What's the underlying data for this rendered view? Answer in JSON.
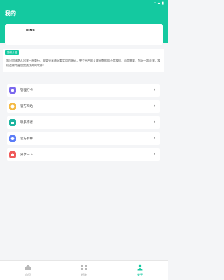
{
  "status": {
    "icons": [
      "wifi-icon",
      "signal-icon",
      "battery-icon"
    ]
  },
  "header": {
    "title": "我的"
  },
  "profile": {
    "username": "mos"
  },
  "intro": {
    "tag": "猫咪介绍",
    "description": "知识加速跑从出来一直重行，支管分享最好看实用的源码，整个平台的互联网数据都不是我们，而是需要，您好一路走来，我们会做得更加完美优秀的软件！"
  },
  "menu": [
    {
      "label": "管理打卡",
      "icon": "user-manage-icon",
      "color": "#7b68ee"
    },
    {
      "label": "官方网站",
      "icon": "website-icon",
      "color": "#f4b942"
    },
    {
      "label": "联系作者",
      "icon": "contact-icon",
      "color": "#1db4a0"
    },
    {
      "label": "官方群聊",
      "icon": "group-chat-icon",
      "color": "#5b7cf7"
    },
    {
      "label": "分享一下",
      "icon": "share-icon",
      "color": "#ef5a5a"
    }
  ],
  "nav": [
    {
      "label": "首页",
      "icon": "home-icon",
      "active": false
    },
    {
      "label": "模块",
      "icon": "grid-icon",
      "active": false
    },
    {
      "label": "关于",
      "icon": "user-icon",
      "active": true
    }
  ],
  "colors": {
    "accent": "#14c9a0"
  }
}
